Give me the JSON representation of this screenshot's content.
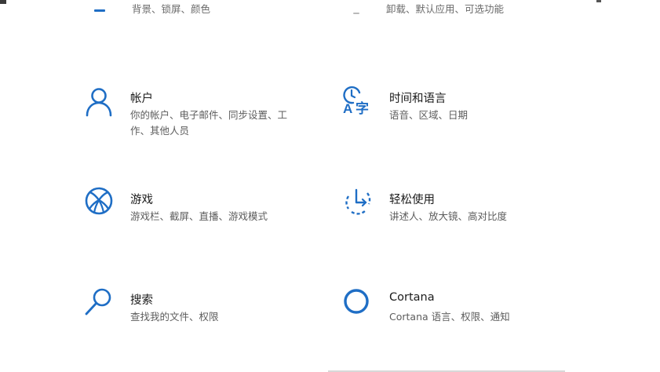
{
  "top_partial": {
    "left_desc": "背景、锁屏、颜色",
    "right_desc": "卸载、默认应用、可选功能"
  },
  "tiles": [
    {
      "title": "帐户",
      "desc": "你的帐户、电子邮件、同步设置、工作、其他人员",
      "icon": "person-icon"
    },
    {
      "title": "时间和语言",
      "desc": "语音、区域、日期",
      "icon": "time-language-icon"
    },
    {
      "title": "游戏",
      "desc": "游戏栏、截屏、直播、游戏模式",
      "icon": "xbox-icon"
    },
    {
      "title": "轻松使用",
      "desc": "讲述人、放大镜、高对比度",
      "icon": "ease-of-access-icon"
    },
    {
      "title": "搜索",
      "desc": "查找我的文件、权限",
      "icon": "search-icon"
    },
    {
      "title": "Cortana",
      "desc": "Cortana 语言、权限、通知",
      "icon": "cortana-icon"
    }
  ],
  "colors": {
    "accent": "#1f6ec5",
    "title": "#1a1a1a",
    "description": "#5d5d5d"
  }
}
